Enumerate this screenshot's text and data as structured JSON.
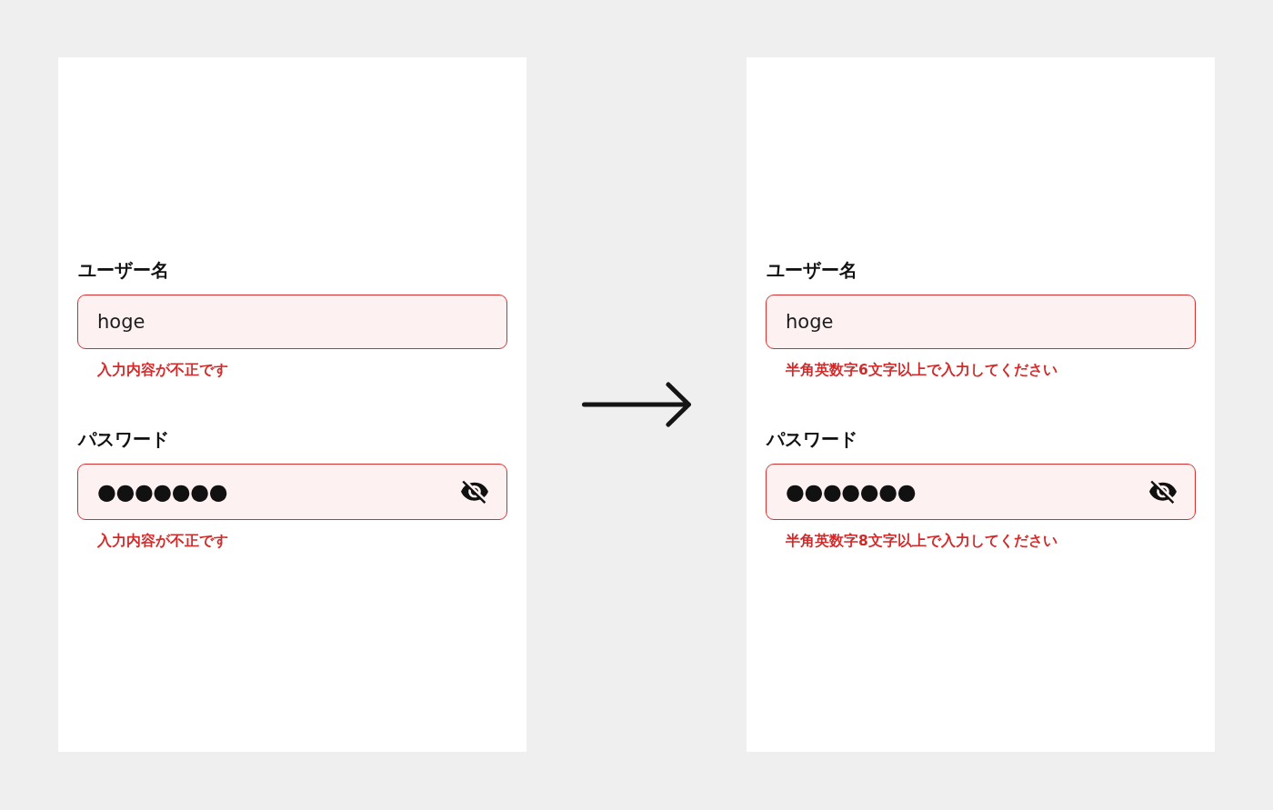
{
  "panels": [
    {
      "fields": [
        {
          "kind": "text",
          "label": "ユーザー名",
          "value": "hoge",
          "invalid": true,
          "error": "入力内容が不正です"
        },
        {
          "kind": "password",
          "label": "パスワード",
          "value": "●●●●●●●",
          "invalid": true,
          "error": "入力内容が不正です"
        }
      ]
    },
    {
      "fields": [
        {
          "kind": "text",
          "label": "ユーザー名",
          "value": "hoge",
          "invalid": true,
          "error": "半角英数字6文字以上で入力してください"
        },
        {
          "kind": "password",
          "label": "パスワード",
          "value": "●●●●●●●",
          "invalid": true,
          "error": "半角英数字8文字以上で入力してください"
        }
      ]
    }
  ]
}
